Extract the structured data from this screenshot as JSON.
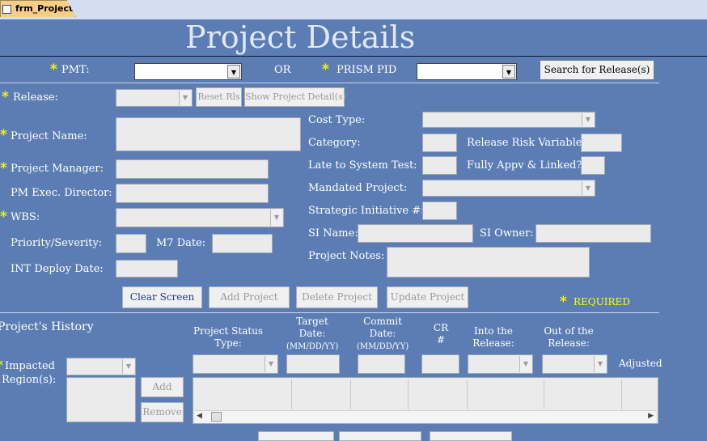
{
  "tab": {
    "label": "frm_Projects"
  },
  "title": "Project Details",
  "search": {
    "pmt_label": "PMT:",
    "or_label": "OR",
    "prism_label": "PRISM PID",
    "search_button": "Search for Release(s)"
  },
  "release": {
    "label": "Release:",
    "reset_button": "Reset Rls",
    "show_button": "Show Project Detail(s)"
  },
  "left_labels": {
    "project_name": "Project Name:",
    "project_manager": "Project Manager:",
    "pm_exec": "PM Exec. Director:",
    "wbs": "WBS:",
    "priority": "Priority/Severity:",
    "m7_date": "M7 Date:",
    "int_deploy": "INT Deploy Date:"
  },
  "right_labels": {
    "cost_type": "Cost Type:",
    "category": "Category:",
    "release_risk": "Release Risk Variable:",
    "late": "Late to System Test:",
    "fully_appv": "Fully Appv & Linked?",
    "mandated": "Mandated Project:",
    "strategic": "Strategic Initiative #:",
    "si_name": "SI Name:",
    "si_owner": "SI Owner:",
    "project_notes": "Project Notes:"
  },
  "actions": {
    "clear": "Clear Screen",
    "add": "Add Project",
    "delete": "Delete Project",
    "update": "Update Project",
    "required": "REQUIRED"
  },
  "history": {
    "title": "Project's History",
    "headers": {
      "status": [
        "Project Status",
        "Type:"
      ],
      "target": [
        "Target",
        "Date:",
        "(MM/DD/YY)"
      ],
      "commit": [
        "Commit",
        "Date:",
        "(MM/DD/YY)"
      ],
      "cr": [
        "CR",
        "#"
      ],
      "into": [
        "Into the",
        "Release:"
      ],
      "outof": [
        "Out of the",
        "Release:"
      ],
      "adjusted": "Adjusted"
    },
    "impacted_label": [
      "Impacted",
      "Region(s):"
    ],
    "add_button": "Add",
    "remove_button": "Remove"
  },
  "colors": {
    "background": "#5b7db4",
    "title": "#dfe8f5",
    "required_star": "#ffff00",
    "tab": "#f6ce88"
  }
}
